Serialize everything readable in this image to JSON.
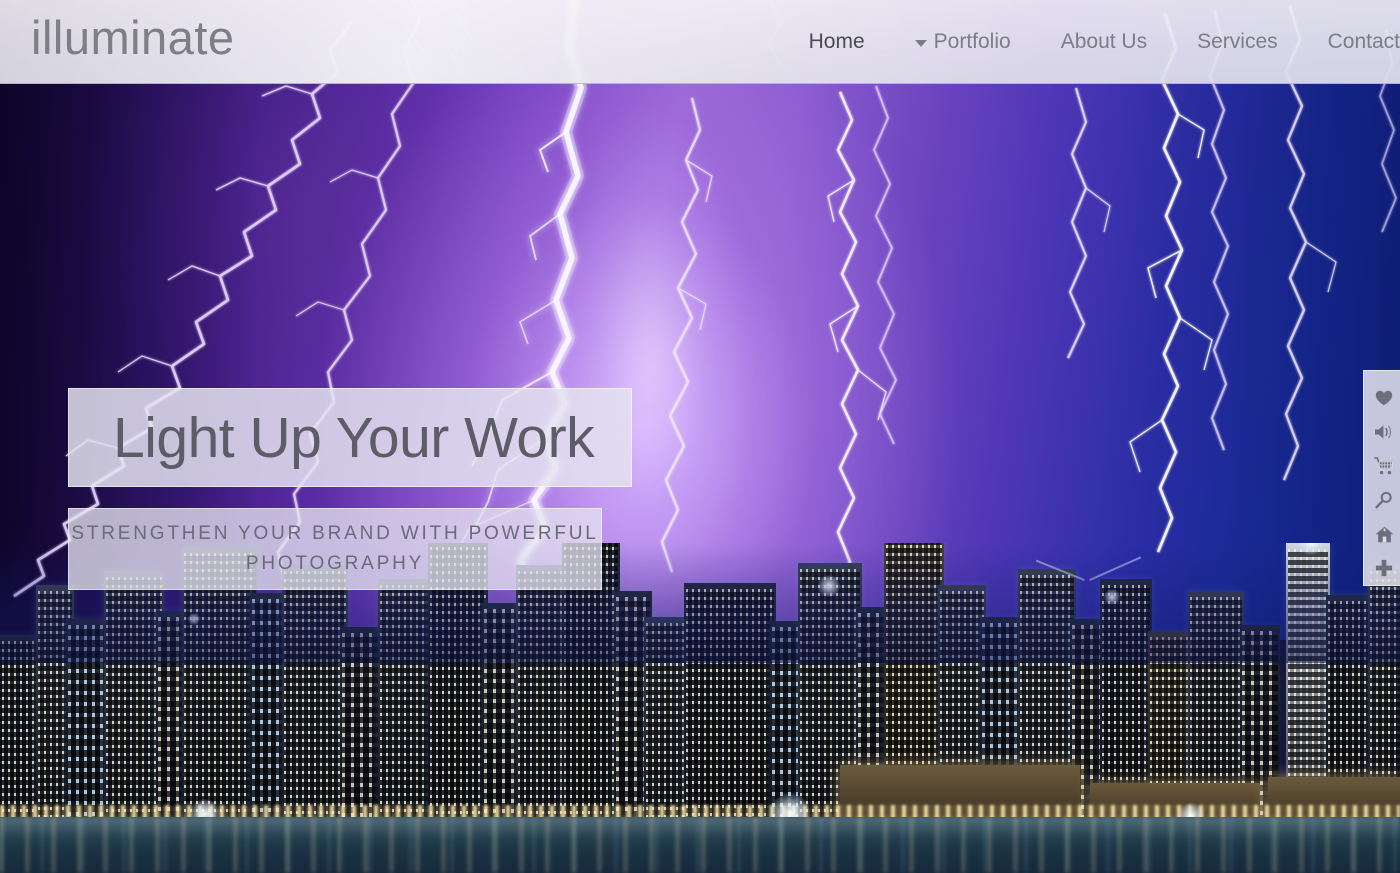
{
  "site": {
    "brand": "illuminate"
  },
  "nav": {
    "items": [
      {
        "label": "Home",
        "active": true,
        "has_dropdown": false
      },
      {
        "label": "Portfolio",
        "active": false,
        "has_dropdown": true
      },
      {
        "label": "About Us",
        "active": false,
        "has_dropdown": false
      },
      {
        "label": "Services",
        "active": false,
        "has_dropdown": false
      },
      {
        "label": "Contact",
        "active": false,
        "has_dropdown": false
      }
    ]
  },
  "hero": {
    "headline": "Light Up Your Work",
    "subheadline": "STRENGTHEN YOUR BRAND WITH POWERFUL PHOTOGRAPHY",
    "image_description": "Night city skyline with purple lightning storm"
  },
  "icon_rail": {
    "items": [
      {
        "icon": "heart-icon",
        "label": "Favorites"
      },
      {
        "icon": "speaker-icon",
        "label": "Sound"
      },
      {
        "icon": "shopping-cart-icon",
        "label": "Cart"
      },
      {
        "icon": "search-icon",
        "label": "Search"
      },
      {
        "icon": "home-icon",
        "label": "Home"
      },
      {
        "icon": "plus-icon",
        "label": "Add"
      }
    ]
  },
  "colors": {
    "header_bg": "#e7e5ef",
    "nav_text": "#7c7d88",
    "nav_active": "#4b4b56",
    "brand_text": "#7e7e86",
    "hero_box_bg": "#e4e3f0",
    "hero_text": "#5d5d68",
    "rail_bg": "#dfdfeb",
    "rail_icon": "#6f6f7c",
    "sky_deep": "#1b0b46",
    "sky_violet": "#9c69d8",
    "sky_blue": "#142a96"
  }
}
